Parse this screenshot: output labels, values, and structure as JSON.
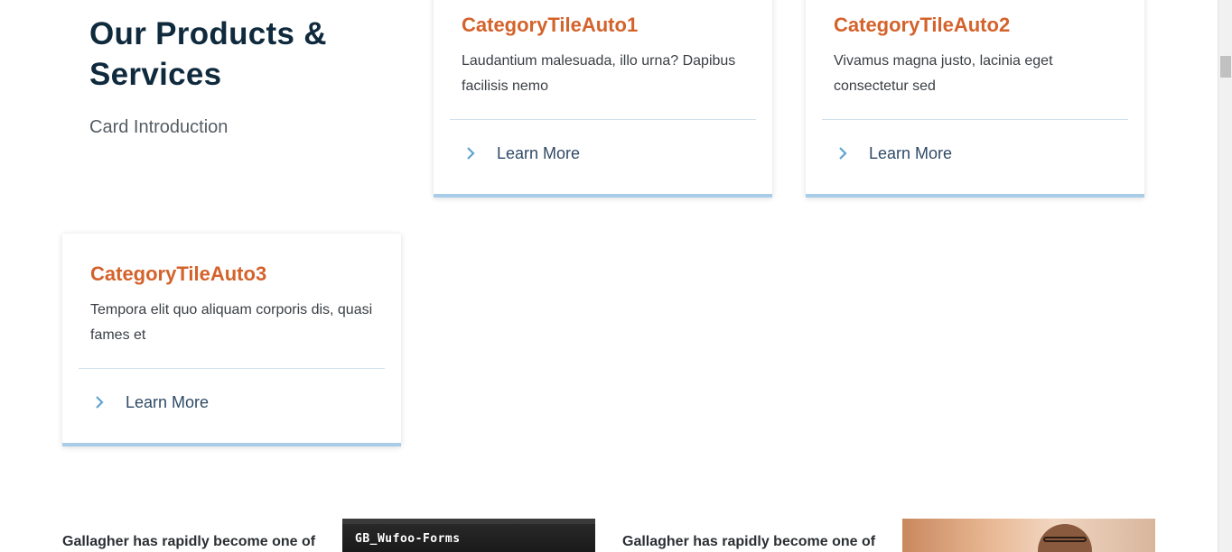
{
  "section": {
    "title": "Our Products & Services",
    "intro": "Card Introduction"
  },
  "cards": [
    {
      "title": "CategoryTileAuto1",
      "text": "Laudantium malesuada, illo urna? Dapibus facilisis nemo",
      "link": "Learn More"
    },
    {
      "title": "CategoryTileAuto2",
      "text": "Vivamus magna justo, lacinia eget consectetur sed",
      "link": "Learn More"
    },
    {
      "title": "CategoryTileAuto3",
      "text": "Tempora elit quo aliquam corporis dis, quasi fames et",
      "link": "Learn More"
    }
  ],
  "promos": [
    {
      "text": "Gallagher has rapidly become one of",
      "media_title": "GB_Wufoo-Forms"
    },
    {
      "text": "Gallagher has rapidly become one of"
    }
  ],
  "colors": {
    "title": "#0f2a3d",
    "card_title": "#d4622b",
    "link": "#2f4a66",
    "chevron": "#5fa3d1",
    "card_border": "#a9cde8"
  },
  "icons": {
    "link": "chevron-right-icon"
  }
}
